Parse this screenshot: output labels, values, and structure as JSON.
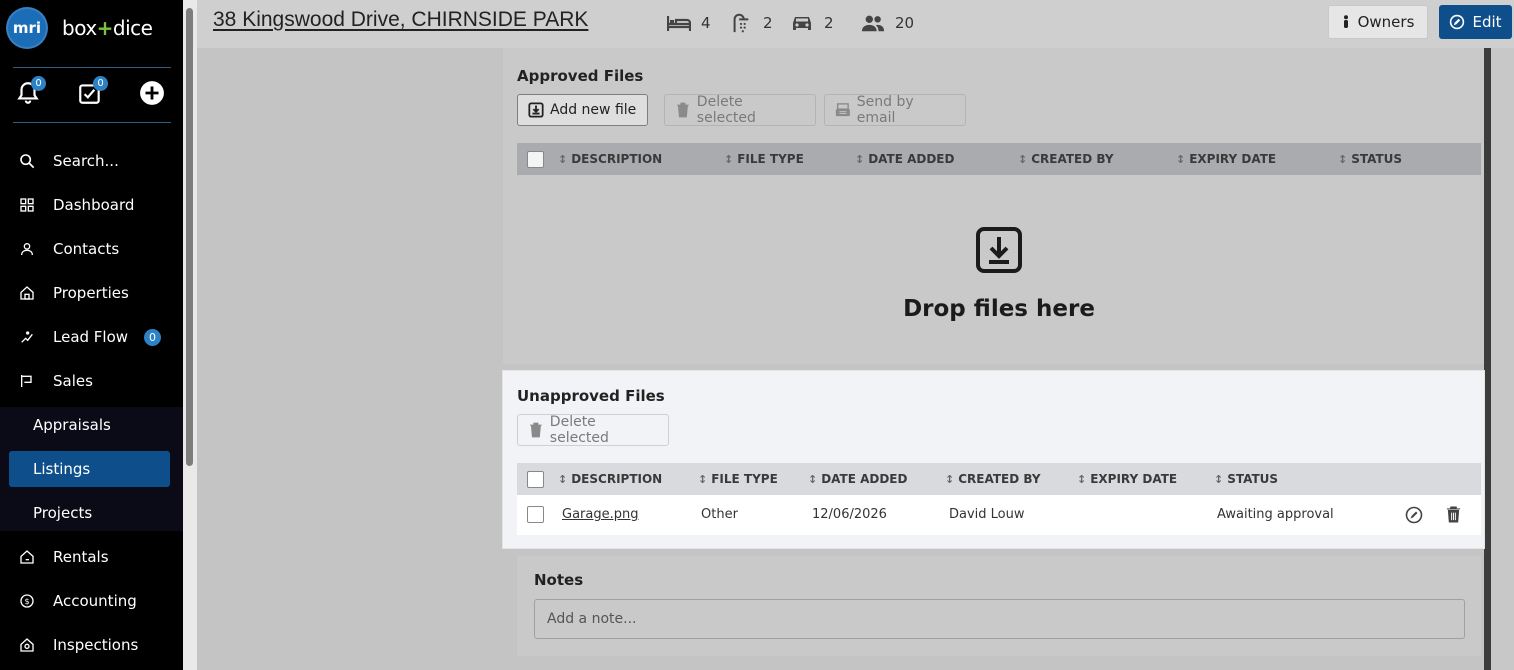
{
  "sidebar": {
    "brand_badge": "mri",
    "brand_left": "box",
    "brand_plus": "+",
    "brand_right": "dice",
    "notifications_count": "0",
    "tasks_count": "0",
    "items": [
      {
        "label": "Search...",
        "icon": "search-icon"
      },
      {
        "label": "Dashboard",
        "icon": "grid-icon"
      },
      {
        "label": "Contacts",
        "icon": "person-icon"
      },
      {
        "label": "Properties",
        "icon": "house-icon"
      },
      {
        "label": "Lead Flow",
        "icon": "lead-icon",
        "badge": "0"
      },
      {
        "label": "Sales",
        "icon": "sign-icon"
      },
      {
        "label": "Appraisals"
      },
      {
        "label": "Listings"
      },
      {
        "label": "Projects"
      },
      {
        "label": "Rentals",
        "icon": "house-key-icon"
      },
      {
        "label": "Accounting",
        "icon": "dollar-icon"
      },
      {
        "label": "Inspections",
        "icon": "house-search-icon"
      }
    ]
  },
  "header": {
    "title": "38 Kingswood Drive, CHIRNSIDE PARK",
    "beds": "4",
    "baths": "2",
    "cars": "2",
    "people": "20",
    "owners_label": "Owners",
    "edit_label": "Edit"
  },
  "approved": {
    "title": "Approved Files",
    "add_label": "Add new file",
    "delete_label": "Delete selected",
    "email_label": "Send by email",
    "columns": [
      "DESCRIPTION",
      "FILE TYPE",
      "DATE ADDED",
      "CREATED BY",
      "EXPIRY DATE",
      "STATUS"
    ],
    "drop_text": "Drop files here"
  },
  "unapproved": {
    "title": "Unapproved Files",
    "delete_label": "Delete selected",
    "columns": [
      "DESCRIPTION",
      "FILE TYPE",
      "DATE ADDED",
      "CREATED BY",
      "EXPIRY DATE",
      "STATUS"
    ],
    "rows": [
      {
        "description": "Garage.png",
        "file_type": "Other",
        "date_added": "12/06/2026",
        "created_by": "David Louw",
        "expiry_date": "",
        "status": "Awaiting approval"
      }
    ]
  },
  "notes": {
    "title": "Notes",
    "placeholder": "Add a note..."
  },
  "colors": {
    "sidebar_bg": "#000000",
    "accent": "#0e4f8b",
    "badge": "#2d82c5",
    "brand_green": "#7ac142"
  }
}
